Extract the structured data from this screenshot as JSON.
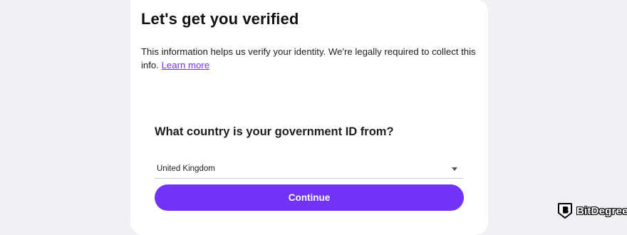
{
  "header": {
    "title": "Let's get you verified"
  },
  "intro": {
    "text": "This information helps us verify your identity. We're legally required to collect this info. ",
    "link_label": "Learn more"
  },
  "form": {
    "question": "What country is your government ID from?",
    "country_select": {
      "selected_value": "United Kingdom",
      "icon": "chevron-down-icon"
    },
    "continue_label": "Continue"
  },
  "watermark": {
    "brand_name": "BitDegree"
  },
  "colors": {
    "accent": "#7133f5",
    "link": "#7b2ee6",
    "page_background": "#f1f0f5",
    "card_background": "#ffffff"
  }
}
